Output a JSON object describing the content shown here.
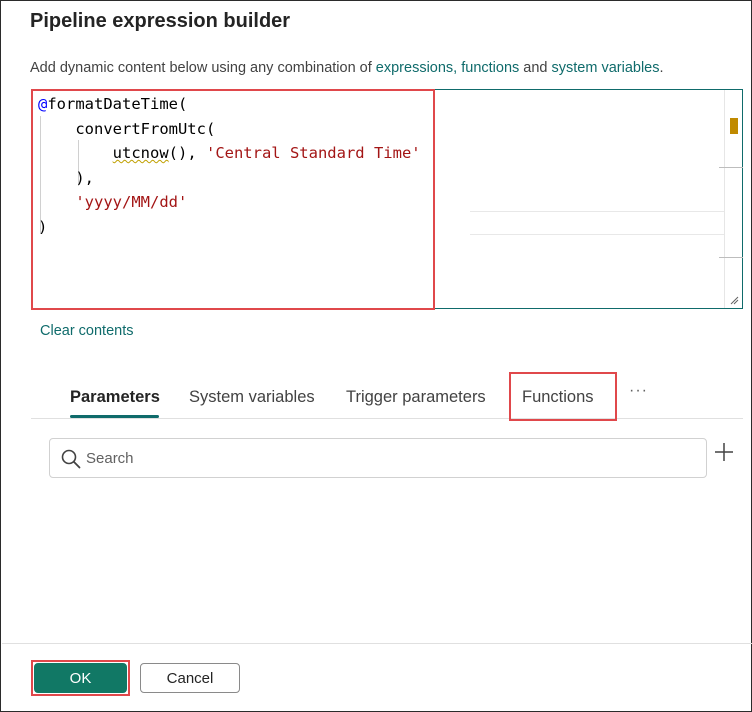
{
  "dialog": {
    "title": "Pipeline expression builder",
    "description_prefix": "Add dynamic content below using any combination of ",
    "link_expressions_functions": "expressions, functions",
    "description_and": " and ",
    "link_system_variables": "system variables",
    "description_suffix": "."
  },
  "editor": {
    "line1_at": "@",
    "line1_fn": "formatDateTime(",
    "line2": "convertFromUtc(",
    "line3_fn": "utcnow",
    "line3_mid": "(), ",
    "line3_str": "'Central Standard Time'",
    "line4": "),",
    "line5_str": "'yyyy/MM/dd'",
    "line6": ")"
  },
  "clear_contents": "Clear contents",
  "tabs": [
    {
      "label": "Parameters",
      "active": true
    },
    {
      "label": "System variables"
    },
    {
      "label": "Trigger parameters"
    },
    {
      "label": "Functions"
    }
  ],
  "more_label": "···",
  "search": {
    "placeholder": "Search"
  },
  "buttons": {
    "ok": "OK",
    "cancel": "Cancel"
  },
  "colors": {
    "accent": "#117865",
    "link": "#0f6b6b",
    "highlight": "#e0484b",
    "string": "#a31515"
  }
}
